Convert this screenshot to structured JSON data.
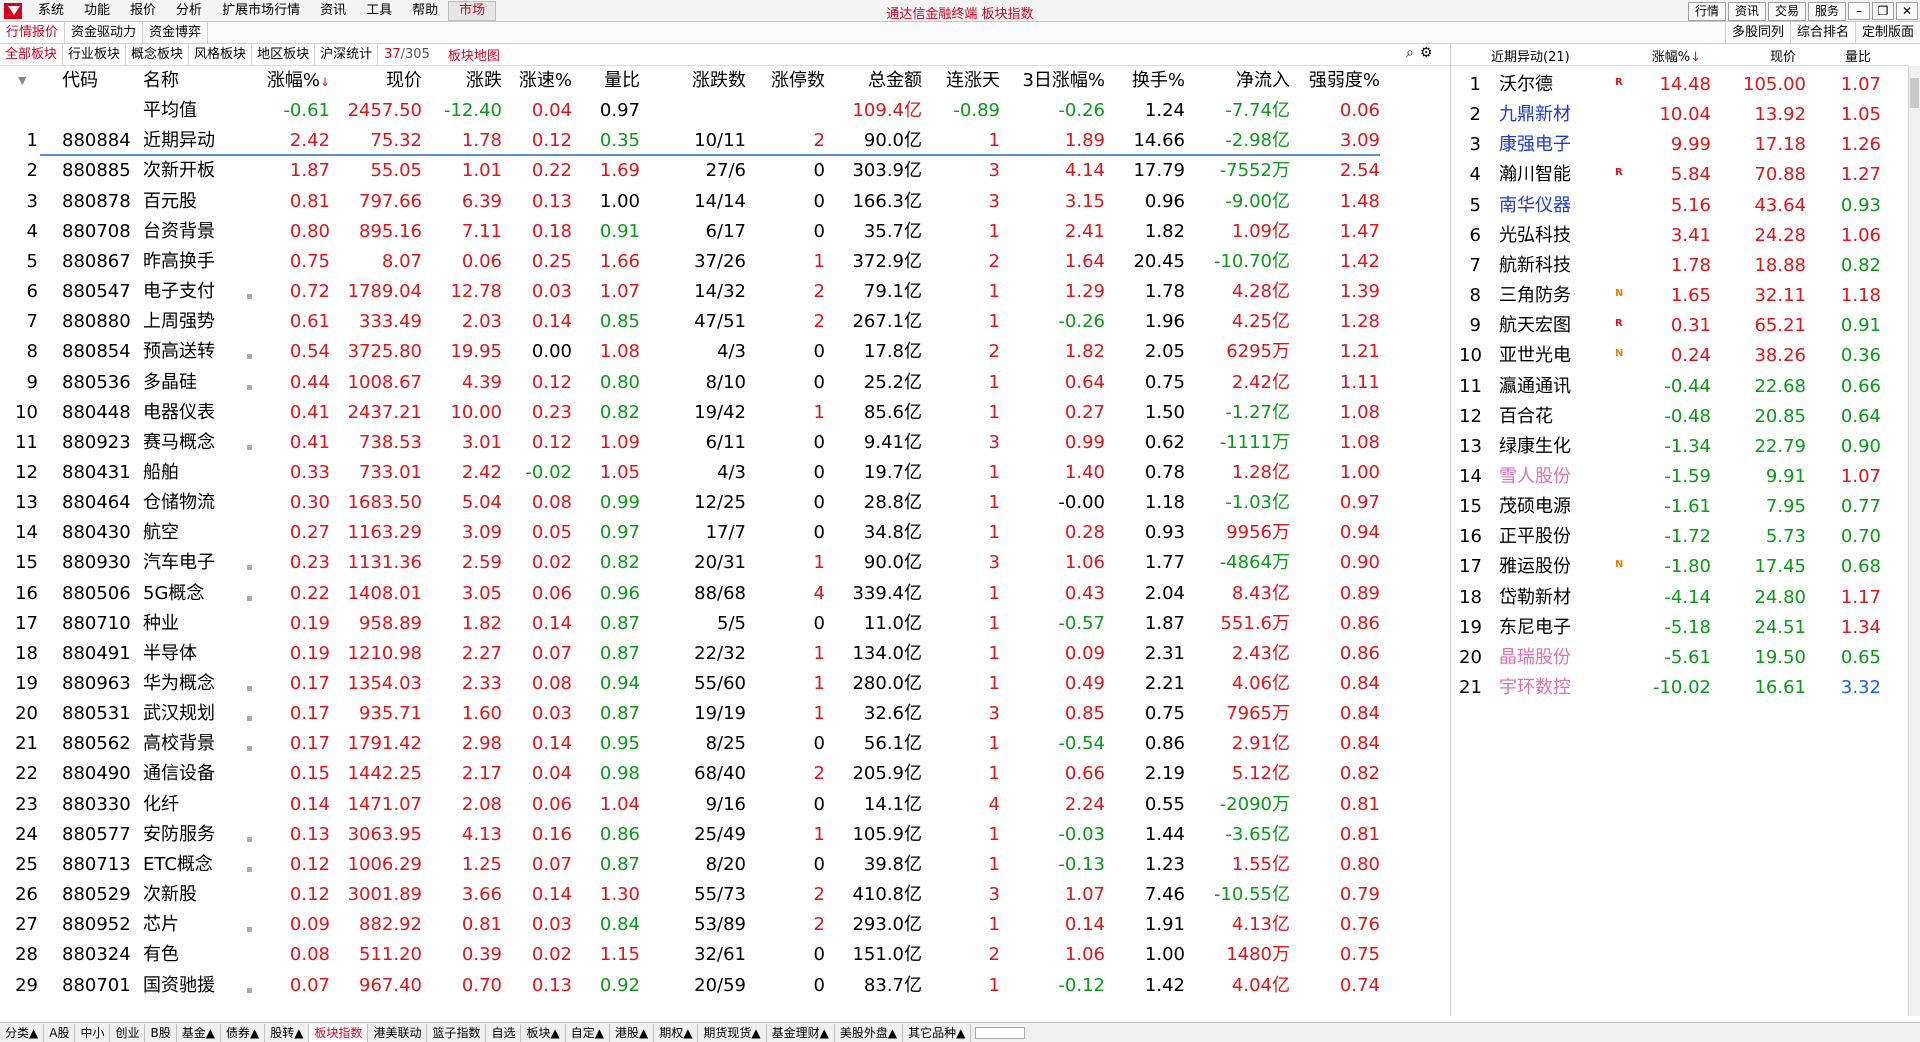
{
  "menubar": {
    "items": [
      "系统",
      "功能",
      "报价",
      "分析",
      "扩展市场行情",
      "资讯",
      "工具",
      "帮助"
    ],
    "active": "市场",
    "title": "通达信金融终端  板块指数",
    "right_buttons": [
      "行情",
      "资讯",
      "交易",
      "服务"
    ]
  },
  "bar2": {
    "tabs": [
      "行情报价",
      "资金驱动力",
      "资金博弈"
    ],
    "right_tabs": [
      "多股同列",
      "综合排名",
      "定制版面"
    ]
  },
  "bar3": {
    "tabs": [
      "全部板块",
      "行业板块",
      "概念板块",
      "风格板块",
      "地区板块",
      "沪深统计"
    ],
    "count_current": "37",
    "count_total": "/305",
    "map": "板块地图"
  },
  "table": {
    "headers": [
      "代码",
      "名称",
      "涨幅%",
      "现价",
      "涨跌",
      "涨速%",
      "量比",
      "涨跌数",
      "涨停数",
      "总金额",
      "连涨天",
      "3日涨幅%",
      "换手%",
      "净流入",
      "强弱度%"
    ],
    "sort_mark": "↓",
    "average": {
      "name": "平均值",
      "chg_pct": "-0.61",
      "price": "2457.50",
      "chg": "-12.40",
      "speed": "0.04",
      "vol_ratio": "0.97",
      "amount": "109.4亿",
      "days": "-0.89",
      "chg3": "-0.26",
      "turnover": "1.24",
      "inflow": "-7.74亿",
      "strength": "0.06"
    },
    "rows": [
      {
        "no": "1",
        "code": "880884",
        "name": "近期异动",
        "mark": false,
        "chg_pct": "2.42",
        "price": "75.32",
        "chg": "1.78",
        "speed": "0.12",
        "vol_ratio": "0.35",
        "updown": "10/11",
        "limit": "2",
        "amount": "90.0亿",
        "days": "1",
        "chg3": "1.89",
        "turnover": "14.66",
        "inflow": "-2.98亿",
        "strength": "3.09"
      },
      {
        "no": "2",
        "code": "880885",
        "name": "次新开板",
        "mark": false,
        "chg_pct": "1.87",
        "price": "55.05",
        "chg": "1.01",
        "speed": "0.22",
        "vol_ratio": "1.69",
        "updown": "27/6",
        "limit": "0",
        "amount": "303.9亿",
        "days": "3",
        "chg3": "4.14",
        "turnover": "17.79",
        "inflow": "-7552万",
        "strength": "2.54"
      },
      {
        "no": "3",
        "code": "880878",
        "name": "百元股",
        "mark": false,
        "chg_pct": "0.81",
        "price": "797.66",
        "chg": "6.39",
        "speed": "0.13",
        "vol_ratio": "1.00",
        "updown": "14/14",
        "limit": "0",
        "amount": "166.3亿",
        "days": "3",
        "chg3": "3.15",
        "turnover": "0.96",
        "inflow": "-9.00亿",
        "strength": "1.48"
      },
      {
        "no": "4",
        "code": "880708",
        "name": "台资背景",
        "mark": false,
        "chg_pct": "0.80",
        "price": "895.16",
        "chg": "7.11",
        "speed": "0.18",
        "vol_ratio": "0.91",
        "updown": "6/17",
        "limit": "0",
        "amount": "35.7亿",
        "days": "1",
        "chg3": "2.41",
        "turnover": "1.82",
        "inflow": "1.09亿",
        "strength": "1.47"
      },
      {
        "no": "5",
        "code": "880867",
        "name": "昨高换手",
        "mark": false,
        "chg_pct": "0.75",
        "price": "8.07",
        "chg": "0.06",
        "speed": "0.25",
        "vol_ratio": "1.66",
        "updown": "37/26",
        "limit": "1",
        "amount": "372.9亿",
        "days": "2",
        "chg3": "1.64",
        "turnover": "20.45",
        "inflow": "-10.70亿",
        "strength": "1.42"
      },
      {
        "no": "6",
        "code": "880547",
        "name": "电子支付",
        "mark": true,
        "chg_pct": "0.72",
        "price": "1789.04",
        "chg": "12.78",
        "speed": "0.03",
        "vol_ratio": "1.07",
        "updown": "14/32",
        "limit": "2",
        "amount": "79.1亿",
        "days": "1",
        "chg3": "1.29",
        "turnover": "1.78",
        "inflow": "4.28亿",
        "strength": "1.39"
      },
      {
        "no": "7",
        "code": "880880",
        "name": "上周强势",
        "mark": false,
        "chg_pct": "0.61",
        "price": "333.49",
        "chg": "2.03",
        "speed": "0.14",
        "vol_ratio": "0.85",
        "updown": "47/51",
        "limit": "2",
        "amount": "267.1亿",
        "days": "1",
        "chg3": "-0.26",
        "turnover": "1.96",
        "inflow": "4.25亿",
        "strength": "1.28"
      },
      {
        "no": "8",
        "code": "880854",
        "name": "预高送转",
        "mark": true,
        "chg_pct": "0.54",
        "price": "3725.80",
        "chg": "19.95",
        "speed": "0.00",
        "vol_ratio": "1.08",
        "updown": "4/3",
        "limit": "0",
        "amount": "17.8亿",
        "days": "2",
        "chg3": "1.82",
        "turnover": "2.05",
        "inflow": "6295万",
        "strength": "1.21"
      },
      {
        "no": "9",
        "code": "880536",
        "name": "多晶硅",
        "mark": true,
        "chg_pct": "0.44",
        "price": "1008.67",
        "chg": "4.39",
        "speed": "0.12",
        "vol_ratio": "0.80",
        "updown": "8/10",
        "limit": "0",
        "amount": "25.2亿",
        "days": "1",
        "chg3": "0.64",
        "turnover": "0.75",
        "inflow": "2.42亿",
        "strength": "1.11"
      },
      {
        "no": "10",
        "code": "880448",
        "name": "电器仪表",
        "mark": false,
        "chg_pct": "0.41",
        "price": "2437.21",
        "chg": "10.00",
        "speed": "0.23",
        "vol_ratio": "0.82",
        "updown": "19/42",
        "limit": "1",
        "amount": "85.6亿",
        "days": "1",
        "chg3": "0.27",
        "turnover": "1.50",
        "inflow": "-1.27亿",
        "strength": "1.08"
      },
      {
        "no": "11",
        "code": "880923",
        "name": "赛马概念",
        "mark": true,
        "chg_pct": "0.41",
        "price": "738.53",
        "chg": "3.01",
        "speed": "0.12",
        "vol_ratio": "1.09",
        "updown": "6/11",
        "limit": "0",
        "amount": "9.41亿",
        "days": "3",
        "chg3": "0.99",
        "turnover": "0.62",
        "inflow": "-1111万",
        "strength": "1.08"
      },
      {
        "no": "12",
        "code": "880431",
        "name": "船舶",
        "mark": false,
        "chg_pct": "0.33",
        "price": "733.01",
        "chg": "2.42",
        "speed": "-0.02",
        "vol_ratio": "1.05",
        "updown": "4/3",
        "limit": "0",
        "amount": "19.7亿",
        "days": "1",
        "chg3": "1.40",
        "turnover": "0.78",
        "inflow": "1.28亿",
        "strength": "1.00"
      },
      {
        "no": "13",
        "code": "880464",
        "name": "仓储物流",
        "mark": false,
        "chg_pct": "0.30",
        "price": "1683.50",
        "chg": "5.04",
        "speed": "0.08",
        "vol_ratio": "0.99",
        "updown": "12/25",
        "limit": "0",
        "amount": "28.8亿",
        "days": "1",
        "chg3": "-0.00",
        "turnover": "1.18",
        "inflow": "-1.03亿",
        "strength": "0.97"
      },
      {
        "no": "14",
        "code": "880430",
        "name": "航空",
        "mark": false,
        "chg_pct": "0.27",
        "price": "1163.29",
        "chg": "3.09",
        "speed": "0.05",
        "vol_ratio": "0.97",
        "updown": "17/7",
        "limit": "0",
        "amount": "34.8亿",
        "days": "1",
        "chg3": "0.28",
        "turnover": "0.93",
        "inflow": "9956万",
        "strength": "0.94"
      },
      {
        "no": "15",
        "code": "880930",
        "name": "汽车电子",
        "mark": true,
        "chg_pct": "0.23",
        "price": "1131.36",
        "chg": "2.59",
        "speed": "0.02",
        "vol_ratio": "0.82",
        "updown": "20/31",
        "limit": "1",
        "amount": "90.0亿",
        "days": "3",
        "chg3": "1.06",
        "turnover": "1.77",
        "inflow": "-4864万",
        "strength": "0.90"
      },
      {
        "no": "16",
        "code": "880506",
        "name": "5G概念",
        "mark": true,
        "chg_pct": "0.22",
        "price": "1408.01",
        "chg": "3.05",
        "speed": "0.06",
        "vol_ratio": "0.96",
        "updown": "88/68",
        "limit": "4",
        "amount": "339.4亿",
        "days": "1",
        "chg3": "0.43",
        "turnover": "2.04",
        "inflow": "8.43亿",
        "strength": "0.89"
      },
      {
        "no": "17",
        "code": "880710",
        "name": "种业",
        "mark": false,
        "chg_pct": "0.19",
        "price": "958.89",
        "chg": "1.82",
        "speed": "0.14",
        "vol_ratio": "0.87",
        "updown": "5/5",
        "limit": "0",
        "amount": "11.0亿",
        "days": "1",
        "chg3": "-0.57",
        "turnover": "1.87",
        "inflow": "551.6万",
        "strength": "0.86"
      },
      {
        "no": "18",
        "code": "880491",
        "name": "半导体",
        "mark": false,
        "chg_pct": "0.19",
        "price": "1210.98",
        "chg": "2.27",
        "speed": "0.07",
        "vol_ratio": "0.87",
        "updown": "22/32",
        "limit": "1",
        "amount": "134.0亿",
        "days": "1",
        "chg3": "0.09",
        "turnover": "2.31",
        "inflow": "2.43亿",
        "strength": "0.86"
      },
      {
        "no": "19",
        "code": "880963",
        "name": "华为概念",
        "mark": true,
        "chg_pct": "0.17",
        "price": "1354.03",
        "chg": "2.33",
        "speed": "0.08",
        "vol_ratio": "0.94",
        "updown": "55/60",
        "limit": "1",
        "amount": "280.0亿",
        "days": "1",
        "chg3": "0.49",
        "turnover": "2.21",
        "inflow": "4.06亿",
        "strength": "0.84"
      },
      {
        "no": "20",
        "code": "880531",
        "name": "武汉规划",
        "mark": true,
        "chg_pct": "0.17",
        "price": "935.71",
        "chg": "1.60",
        "speed": "0.03",
        "vol_ratio": "0.87",
        "updown": "19/19",
        "limit": "1",
        "amount": "32.6亿",
        "days": "3",
        "chg3": "0.85",
        "turnover": "0.75",
        "inflow": "7965万",
        "strength": "0.84"
      },
      {
        "no": "21",
        "code": "880562",
        "name": "高校背景",
        "mark": true,
        "chg_pct": "0.17",
        "price": "1791.42",
        "chg": "2.98",
        "speed": "0.14",
        "vol_ratio": "0.95",
        "updown": "8/25",
        "limit": "0",
        "amount": "56.1亿",
        "days": "1",
        "chg3": "-0.54",
        "turnover": "0.86",
        "inflow": "2.91亿",
        "strength": "0.84"
      },
      {
        "no": "22",
        "code": "880490",
        "name": "通信设备",
        "mark": false,
        "chg_pct": "0.15",
        "price": "1442.25",
        "chg": "2.17",
        "speed": "0.04",
        "vol_ratio": "0.98",
        "updown": "68/40",
        "limit": "2",
        "amount": "205.9亿",
        "days": "1",
        "chg3": "0.66",
        "turnover": "2.19",
        "inflow": "5.12亿",
        "strength": "0.82"
      },
      {
        "no": "23",
        "code": "880330",
        "name": "化纤",
        "mark": false,
        "chg_pct": "0.14",
        "price": "1471.07",
        "chg": "2.08",
        "speed": "0.06",
        "vol_ratio": "1.04",
        "updown": "9/16",
        "limit": "0",
        "amount": "14.1亿",
        "days": "4",
        "chg3": "2.24",
        "turnover": "0.55",
        "inflow": "-2090万",
        "strength": "0.81"
      },
      {
        "no": "24",
        "code": "880577",
        "name": "安防服务",
        "mark": true,
        "chg_pct": "0.13",
        "price": "3063.95",
        "chg": "4.13",
        "speed": "0.16",
        "vol_ratio": "0.86",
        "updown": "25/49",
        "limit": "1",
        "amount": "105.9亿",
        "days": "1",
        "chg3": "-0.03",
        "turnover": "1.44",
        "inflow": "-3.65亿",
        "strength": "0.81"
      },
      {
        "no": "25",
        "code": "880713",
        "name": "ETC概念",
        "mark": true,
        "chg_pct": "0.12",
        "price": "1006.29",
        "chg": "1.25",
        "speed": "0.07",
        "vol_ratio": "0.87",
        "updown": "8/20",
        "limit": "0",
        "amount": "39.8亿",
        "days": "1",
        "chg3": "-0.13",
        "turnover": "1.23",
        "inflow": "1.55亿",
        "strength": "0.80"
      },
      {
        "no": "26",
        "code": "880529",
        "name": "次新股",
        "mark": false,
        "chg_pct": "0.12",
        "price": "3001.89",
        "chg": "3.66",
        "speed": "0.14",
        "vol_ratio": "1.30",
        "updown": "55/73",
        "limit": "2",
        "amount": "410.8亿",
        "days": "3",
        "chg3": "1.07",
        "turnover": "7.46",
        "inflow": "-10.55亿",
        "strength": "0.79"
      },
      {
        "no": "27",
        "code": "880952",
        "name": "芯片",
        "mark": true,
        "chg_pct": "0.09",
        "price": "882.92",
        "chg": "0.81",
        "speed": "0.03",
        "vol_ratio": "0.84",
        "updown": "53/89",
        "limit": "2",
        "amount": "293.0亿",
        "days": "1",
        "chg3": "0.14",
        "turnover": "1.91",
        "inflow": "4.13亿",
        "strength": "0.76"
      },
      {
        "no": "28",
        "code": "880324",
        "name": "有色",
        "mark": false,
        "chg_pct": "0.08",
        "price": "511.20",
        "chg": "0.39",
        "speed": "0.02",
        "vol_ratio": "1.15",
        "updown": "32/61",
        "limit": "0",
        "amount": "151.0亿",
        "days": "2",
        "chg3": "1.06",
        "turnover": "1.00",
        "inflow": "1480万",
        "strength": "0.75"
      },
      {
        "no": "29",
        "code": "880701",
        "name": "国资驰援",
        "mark": true,
        "chg_pct": "0.07",
        "price": "967.40",
        "chg": "0.70",
        "speed": "0.13",
        "vol_ratio": "0.92",
        "updown": "20/59",
        "limit": "0",
        "amount": "83.7亿",
        "days": "1",
        "chg3": "-0.12",
        "turnover": "1.42",
        "inflow": "4.04亿",
        "strength": "0.74"
      }
    ]
  },
  "rpanel": {
    "title": "近期异动(21)",
    "headers": [
      "涨幅%",
      "现价",
      "量比"
    ],
    "sort_mark": "↓",
    "rows": [
      {
        "no": "1",
        "name": "沃尔德",
        "flag": "R",
        "chg": "14.48",
        "price": "105.00",
        "vr": "1.07",
        "name_color": "black",
        "vr_color": "up"
      },
      {
        "no": "2",
        "name": "九鼎新材",
        "flag": "",
        "chg": "10.04",
        "price": "13.92",
        "vr": "1.05",
        "name_color": "blue",
        "vr_color": "up"
      },
      {
        "no": "3",
        "name": "康强电子",
        "flag": "",
        "chg": "9.99",
        "price": "17.18",
        "vr": "1.26",
        "name_color": "blue",
        "vr_color": "up"
      },
      {
        "no": "4",
        "name": "瀚川智能",
        "flag": "R",
        "chg": "5.84",
        "price": "70.88",
        "vr": "1.27",
        "name_color": "black",
        "vr_color": "up"
      },
      {
        "no": "5",
        "name": "南华仪器",
        "flag": "",
        "chg": "5.16",
        "price": "43.64",
        "vr": "0.93",
        "name_color": "blue",
        "vr_color": "dn"
      },
      {
        "no": "6",
        "name": "光弘科技",
        "flag": "",
        "chg": "3.41",
        "price": "24.28",
        "vr": "1.06",
        "name_color": "black",
        "vr_color": "up"
      },
      {
        "no": "7",
        "name": "航新科技",
        "flag": "",
        "chg": "1.78",
        "price": "18.88",
        "vr": "0.82",
        "name_color": "black",
        "vr_color": "dn"
      },
      {
        "no": "8",
        "name": "三角防务",
        "flag": "N",
        "chg": "1.65",
        "price": "32.11",
        "vr": "1.18",
        "name_color": "black",
        "vr_color": "up"
      },
      {
        "no": "9",
        "name": "航天宏图",
        "flag": "R",
        "chg": "0.31",
        "price": "65.21",
        "vr": "0.91",
        "name_color": "black",
        "vr_color": "dn"
      },
      {
        "no": "10",
        "name": "亚世光电",
        "flag": "N",
        "chg": "0.24",
        "price": "38.26",
        "vr": "0.36",
        "name_color": "black",
        "vr_color": "dn"
      },
      {
        "no": "11",
        "name": "瀛通通讯",
        "flag": "",
        "chg": "-0.44",
        "price": "22.68",
        "vr": "0.66",
        "name_color": "black",
        "vr_color": "dn"
      },
      {
        "no": "12",
        "name": "百合花",
        "flag": "",
        "chg": "-0.48",
        "price": "20.85",
        "vr": "0.64",
        "name_color": "black",
        "vr_color": "dn"
      },
      {
        "no": "13",
        "name": "绿康生化",
        "flag": "",
        "chg": "-1.34",
        "price": "22.79",
        "vr": "0.90",
        "name_color": "black",
        "vr_color": "dn"
      },
      {
        "no": "14",
        "name": "雪人股份",
        "flag": "",
        "chg": "-1.59",
        "price": "9.91",
        "vr": "1.07",
        "name_color": "pink",
        "vr_color": "up"
      },
      {
        "no": "15",
        "name": "茂硕电源",
        "flag": "",
        "chg": "-1.61",
        "price": "7.95",
        "vr": "0.77",
        "name_color": "black",
        "vr_color": "dn"
      },
      {
        "no": "16",
        "name": "正平股份",
        "flag": "",
        "chg": "-1.72",
        "price": "5.73",
        "vr": "0.70",
        "name_color": "black",
        "vr_color": "dn"
      },
      {
        "no": "17",
        "name": "雅运股份",
        "flag": "N",
        "chg": "-1.80",
        "price": "17.45",
        "vr": "0.68",
        "name_color": "black",
        "vr_color": "dn"
      },
      {
        "no": "18",
        "name": "岱勒新材",
        "flag": "",
        "chg": "-4.14",
        "price": "24.80",
        "vr": "1.17",
        "name_color": "black",
        "vr_color": "up"
      },
      {
        "no": "19",
        "name": "东尼电子",
        "flag": "",
        "chg": "-5.18",
        "price": "24.51",
        "vr": "1.34",
        "name_color": "black",
        "vr_color": "up"
      },
      {
        "no": "20",
        "name": "晶瑞股份",
        "flag": "",
        "chg": "-5.61",
        "price": "19.50",
        "vr": "0.65",
        "name_color": "pink",
        "vr_color": "dn"
      },
      {
        "no": "21",
        "name": "宇环数控",
        "flag": "",
        "chg": "-10.02",
        "price": "16.61",
        "vr": "3.32",
        "name_color": "pink",
        "vr_color": "lblue"
      }
    ]
  },
  "bottom_tabs": [
    "分类▲",
    "A股",
    "中小",
    "创业",
    "B股",
    "基金▲",
    "债券▲",
    "股转▲",
    "板块指数",
    "港美联动",
    "篮子指数",
    "自选",
    "板块▲",
    "自定▲",
    "港股▲",
    "期权▲",
    "期货现货▲",
    "基金理财▲",
    "美股外盘▲",
    "其它品种▲"
  ],
  "bottom_active": "板块指数",
  "colors": {
    "up": "#e0151a",
    "down": "#0a9a18",
    "accent": "#d9001b",
    "line": "#5b8ed6"
  }
}
